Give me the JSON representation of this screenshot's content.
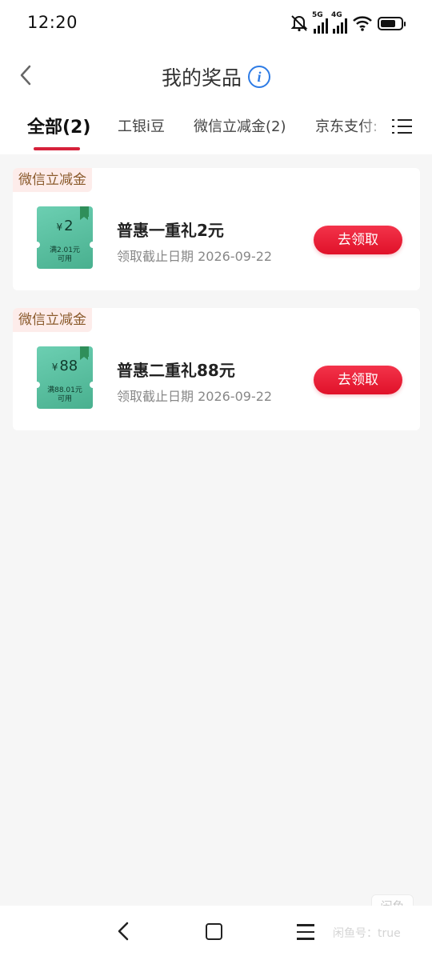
{
  "status_bar": {
    "time": "12:20",
    "network_1": "5G",
    "network_2": "4G",
    "icons": [
      "mute-icon",
      "signal-icon",
      "signal-icon",
      "wifi-icon",
      "battery-icon"
    ]
  },
  "header": {
    "title": "我的奖品",
    "back_icon": "chevron-left-icon",
    "info_icon": "info-icon",
    "info_glyph": "i"
  },
  "tabs": [
    {
      "label": "全部(2)",
      "active": true
    },
    {
      "label": "工银i豆",
      "active": false
    },
    {
      "label": "微信立减金(2)",
      "active": false
    },
    {
      "label": "京东支付:",
      "active": false
    }
  ],
  "tab_menu_icon": "list-icon",
  "colors": {
    "accent": "#d6213a",
    "button": "#e8182f",
    "tag_bg": "#fdecea",
    "tag_text": "#8a5a2b",
    "coupon": "#5cc2a3",
    "info": "#2d7be5"
  },
  "prizes": [
    {
      "category": "微信立减金",
      "currency": "¥",
      "amount": "2",
      "condition": "满2.01元",
      "condition_2": "可用",
      "name": "普惠一重礼2元",
      "deadline": "领取截止日期 2026-09-22",
      "button": "去领取"
    },
    {
      "category": "微信立减金",
      "currency": "¥",
      "amount": "88",
      "condition": "满88.01元",
      "condition_2": "可用",
      "name": "普惠二重礼88元",
      "deadline": "领取截止日期 2026-09-22",
      "button": "去领取"
    }
  ],
  "system_nav": {
    "icons": [
      "back-icon",
      "home-icon",
      "menu-icon"
    ]
  },
  "watermark": {
    "logo": "闲鱼",
    "text": "闲鱼号：true"
  }
}
